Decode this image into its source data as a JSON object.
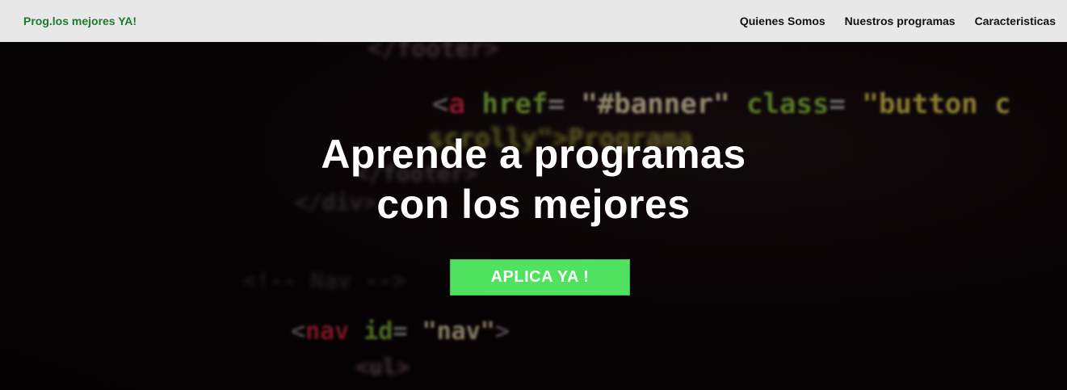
{
  "navbar": {
    "brand": "Prog.los mejores YA!",
    "links": [
      "Quienes Somos",
      "Nuestros programas",
      "Caracteristicas"
    ]
  },
  "hero": {
    "title_line1": "Aprende a programas",
    "title_line2": "con los mejores",
    "cta_label": "APLICA YA !",
    "code_lines": [
      "</footer>",
      "<a href=\"#banner\" class=\"button c",
      "scrolly\">Programa",
      "</footer>",
      "</div>",
      "<!-- Nav -->",
      "<nav id=\"nav\">",
      "<ul>"
    ]
  },
  "colors": {
    "navbar_bg": "#e8e8e8",
    "brand": "#1f7a2c",
    "cta": "#4ee25f",
    "hero_bg": "#0a0406"
  }
}
